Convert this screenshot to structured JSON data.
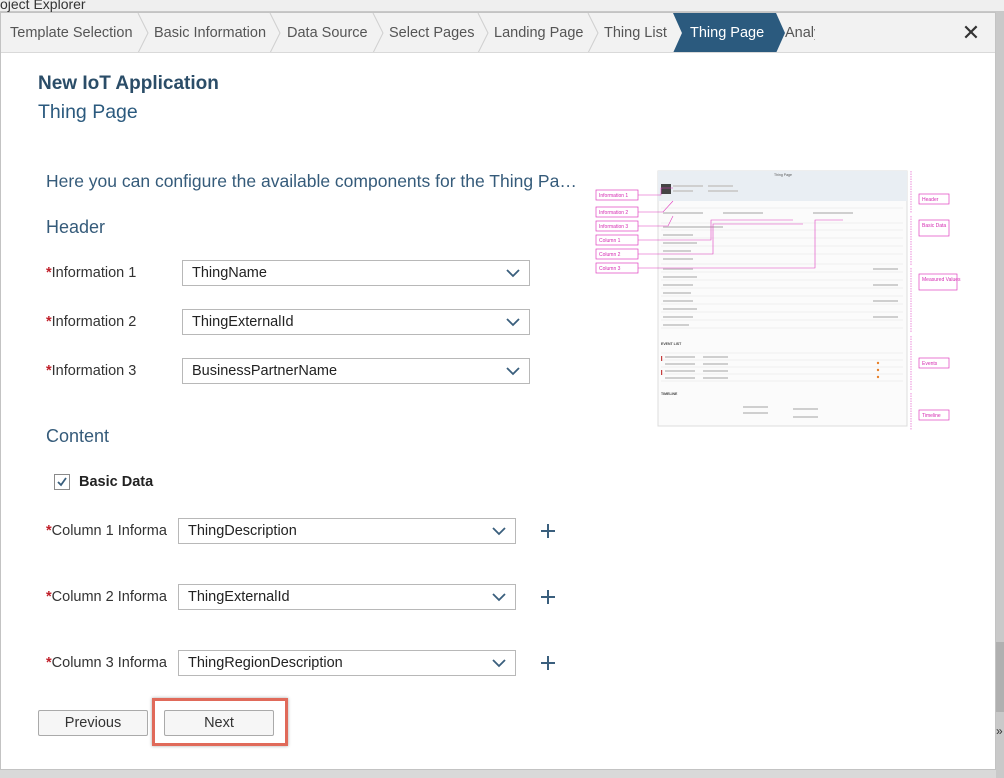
{
  "background": {
    "top_text": "oject Explorer",
    "right_text": "»"
  },
  "wizard": {
    "steps": [
      {
        "label": "Template Selection"
      },
      {
        "label": "Basic Information"
      },
      {
        "label": "Data Source"
      },
      {
        "label": "Select Pages"
      },
      {
        "label": "Landing Page"
      },
      {
        "label": "Thing List"
      },
      {
        "label": "Thing Page",
        "active": true
      },
      {
        "label": "Analy"
      }
    ],
    "close_label": "✕"
  },
  "app_title": "New IoT Application",
  "page_title": "Thing Page",
  "intro_text": "Here you can configure the available components for the Thing Page.",
  "header_section": {
    "title": "Header",
    "fields": [
      {
        "required_mark": "*",
        "label": "Information 1",
        "value": "ThingName"
      },
      {
        "required_mark": "*",
        "label": "Information 2",
        "value": "ThingExternalId"
      },
      {
        "required_mark": "*",
        "label": "Information 3",
        "value": "BusinessPartnerName"
      }
    ]
  },
  "content_section": {
    "title": "Content",
    "basic_data_label": "Basic Data",
    "basic_data_checked": true,
    "fields": [
      {
        "required_mark": "*",
        "label": "Column 1 Informa",
        "value": "ThingDescription"
      },
      {
        "required_mark": "*",
        "label": "Column 2 Informa",
        "value": "ThingExternalId"
      },
      {
        "required_mark": "*",
        "label": "Column 3 Informa",
        "value": "ThingRegionDescription"
      }
    ]
  },
  "buttons": {
    "previous": "Previous",
    "next": "Next"
  },
  "preview": {
    "title": "Thing Page",
    "left_callouts": [
      "Information 1",
      "Information 2",
      "Information 3",
      "Column 1",
      "Column 2",
      "Column 3"
    ],
    "right_callouts": [
      "Header",
      "Basic\nData",
      "Measured\nValues",
      "Events",
      "Timeline"
    ],
    "section_labels": [
      "EVENT LIST",
      "TIMELINE"
    ]
  },
  "colors": {
    "active_step": "#2b5a7e",
    "required": "#c0202a",
    "callout": "#e040c0",
    "highlight": "#e06a5a"
  }
}
